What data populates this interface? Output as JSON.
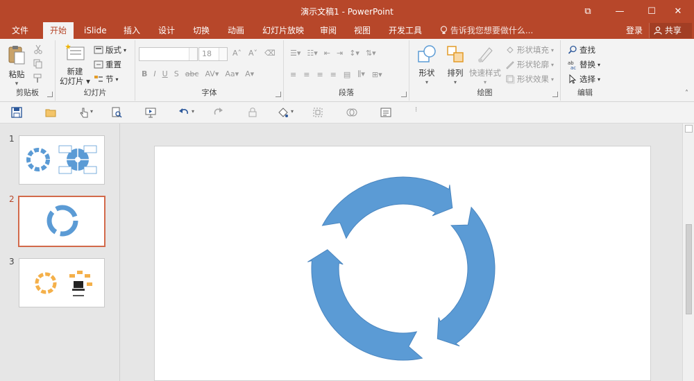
{
  "window": {
    "title": "演示文稿1 - PowerPoint",
    "controls": [
      "⧉",
      "—",
      "☐",
      "✕"
    ]
  },
  "menu": {
    "file": "文件",
    "home": "开始",
    "islide": "iSlide",
    "insert": "插入",
    "design": "设计",
    "transitions": "切换",
    "animations": "动画",
    "slideshow": "幻灯片放映",
    "review": "审阅",
    "view": "视图",
    "developer": "开发工具",
    "tellme": "告诉我您想要做什么...",
    "login": "登录",
    "share": "共享"
  },
  "ribbon": {
    "clipboard": {
      "paste": "粘贴",
      "label": "剪贴板"
    },
    "slides": {
      "new_line1": "新建",
      "new_line2": "幻灯片",
      "layout": "版式",
      "reset": "重置",
      "section": "节",
      "label": "幻灯片"
    },
    "font": {
      "font_size": "18",
      "label": "字体"
    },
    "paragraph": {
      "label": "段落"
    },
    "drawing": {
      "shapes": "形状",
      "arrange": "排列",
      "quick_styles": "快速样式",
      "fill": "形状填充",
      "outline": "形状轮廓",
      "effects": "形状效果",
      "label": "绘图"
    },
    "editing": {
      "find": "查找",
      "replace": "替换",
      "select": "选择",
      "label": "编辑"
    }
  },
  "thumbnails": [
    {
      "number": "1"
    },
    {
      "number": "2"
    },
    {
      "number": "3"
    }
  ],
  "colors": {
    "brand": "#b7472a",
    "shape_blue": "#5b9bd5",
    "shape_orange": "#f4b04a"
  }
}
